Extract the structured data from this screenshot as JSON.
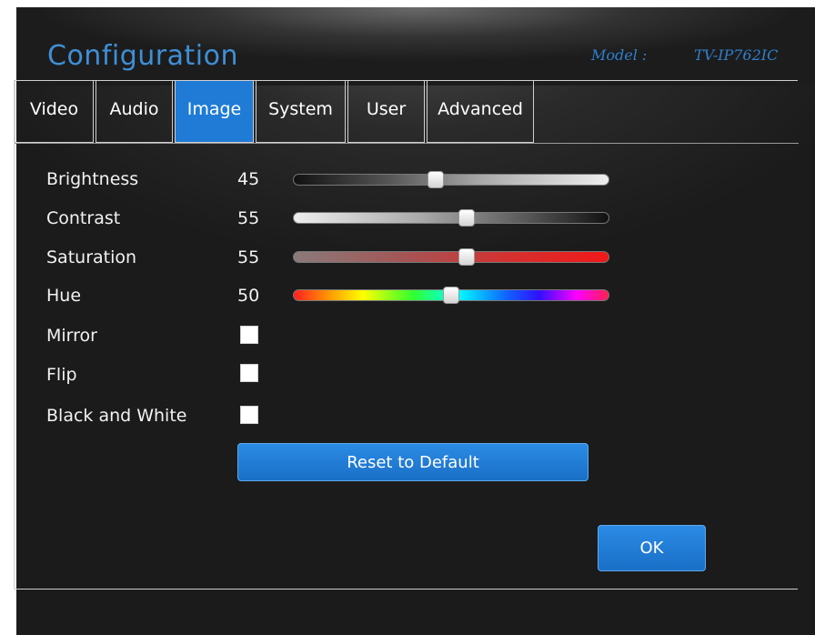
{
  "header": {
    "title": "Configuration",
    "model_label": "Model :",
    "model_value": "TV-IP762IC"
  },
  "tabs": [
    {
      "label": "Video",
      "active": false
    },
    {
      "label": "Audio",
      "active": false
    },
    {
      "label": "Image",
      "active": true
    },
    {
      "label": "System",
      "active": false
    },
    {
      "label": "User",
      "active": false
    },
    {
      "label": "Advanced",
      "active": false
    }
  ],
  "sliders": [
    {
      "label": "Brightness",
      "value": "45",
      "level": 45
    },
    {
      "label": "Contrast",
      "value": "55",
      "level": 55
    },
    {
      "label": "Saturation",
      "value": "55",
      "level": 55
    },
    {
      "label": "Hue",
      "value": "50",
      "level": 50
    }
  ],
  "checkboxes": [
    {
      "label": "Mirror",
      "checked": false
    },
    {
      "label": "Flip",
      "checked": false
    },
    {
      "label": "Black and White",
      "checked": false
    }
  ],
  "buttons": {
    "reset_label": "Reset to Default",
    "ok_label": "OK"
  },
  "colors": {
    "accent": "#1f7bd6",
    "title": "#3f8fd6"
  }
}
